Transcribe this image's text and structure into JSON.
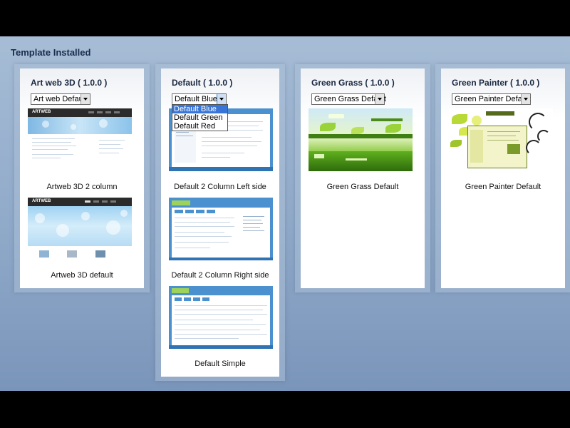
{
  "page": {
    "title": "Template Installed",
    "colors": {
      "background_top": "#a7bdd6",
      "background_bottom": "#7a95ba",
      "dropdown_highlight": "#3875d7",
      "title_text": "#1a2840"
    }
  },
  "templates": [
    {
      "title": "Art web 3D ( 1.0.0 )",
      "select_value": "Art web Default",
      "layouts": [
        {
          "caption": "Artweb 3D 2 column",
          "thumbnail_brand": "ARTWEB"
        },
        {
          "caption": "Artweb 3D default",
          "thumbnail_brand": "ARTWEB"
        }
      ]
    },
    {
      "title": "Default ( 1.0.0 )",
      "select_value": "Default Blue",
      "dropdown_open": true,
      "options": [
        "Default Blue",
        "Default Green",
        "Default Red"
      ],
      "selected_option": "Default Blue",
      "layouts": [
        {
          "caption": "Default 2 Column Left side"
        },
        {
          "caption": "Default 2 Column Right side"
        },
        {
          "caption": "Default Simple"
        }
      ]
    },
    {
      "title": "Green Grass ( 1.0.0 )",
      "select_value": "Green Grass Default",
      "layouts": [
        {
          "caption": "Green Grass Default"
        }
      ]
    },
    {
      "title": "Green Painter ( 1.0.0 )",
      "select_value": "Green Painter Default",
      "layouts": [
        {
          "caption": "Green Painter Default"
        }
      ]
    }
  ]
}
